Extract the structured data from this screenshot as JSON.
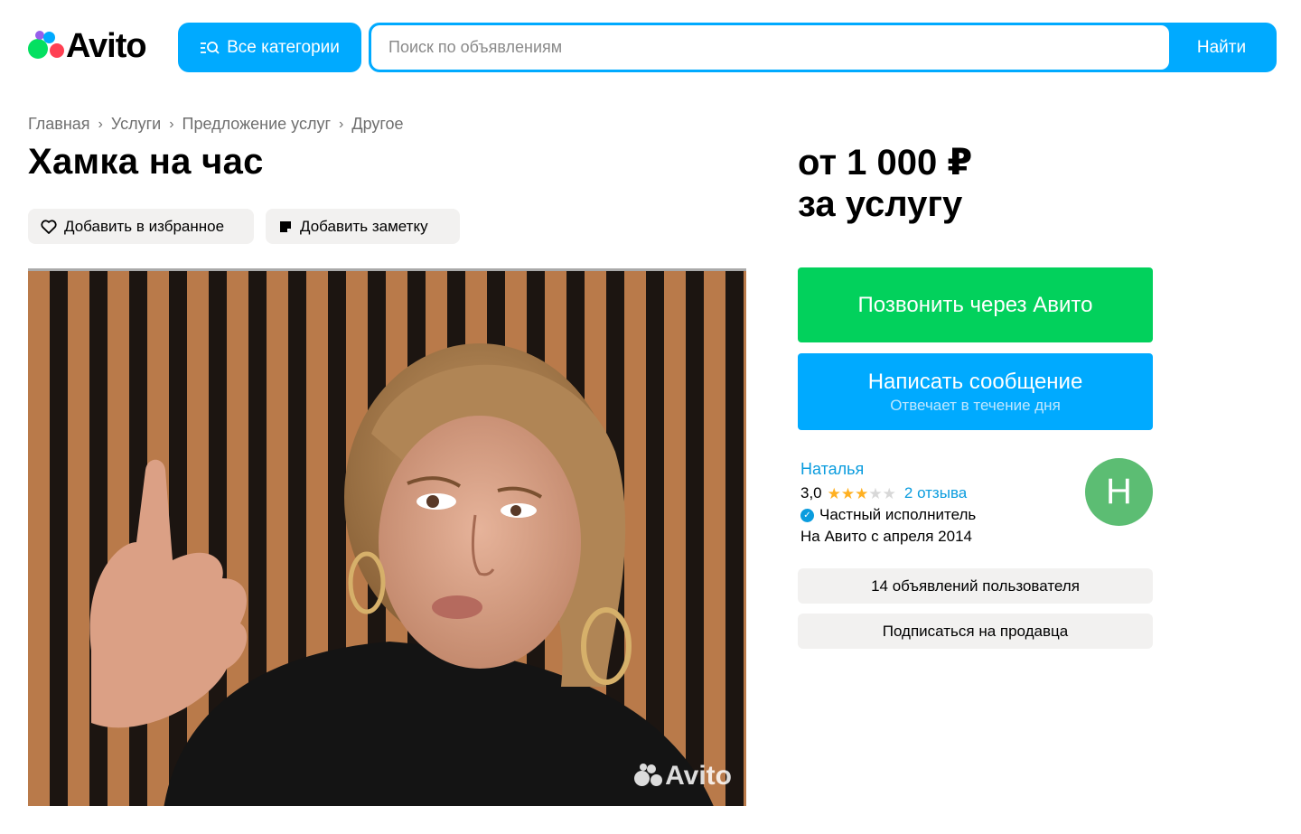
{
  "header": {
    "logo_text": "Avito",
    "categories_label": "Все категории",
    "search_placeholder": "Поиск по объявлениям",
    "search_button": "Найти"
  },
  "breadcrumb": [
    "Главная",
    "Услуги",
    "Предложение услуг",
    "Другое"
  ],
  "listing": {
    "title": "Хамка на час",
    "favorite_label": "Добавить в избранное",
    "note_label": "Добавить заметку",
    "photo_watermark": "Avito",
    "price_line1": "от 1 000 ₽",
    "price_line2": "за услугу"
  },
  "contact": {
    "call_label": "Позвонить через Авито",
    "message_label": "Написать сообщение",
    "message_sub": "Отвечает в течение дня"
  },
  "seller": {
    "name": "Наталья",
    "rating": "3,0",
    "stars_filled": 3,
    "stars_total": 5,
    "reviews": "2 отзыва",
    "type": "Частный исполнитель",
    "since": "На Авито с апреля 2014",
    "avatar_letter": "Н",
    "ads_button": "14 объявлений пользователя",
    "subscribe_button": "Подписаться на продавца"
  },
  "colors": {
    "brand_blue": "#00aaff",
    "call_green": "#02d15c",
    "link_blue": "#0a9cde",
    "star": "#ffb021",
    "avatar_bg": "#5cbd73"
  }
}
